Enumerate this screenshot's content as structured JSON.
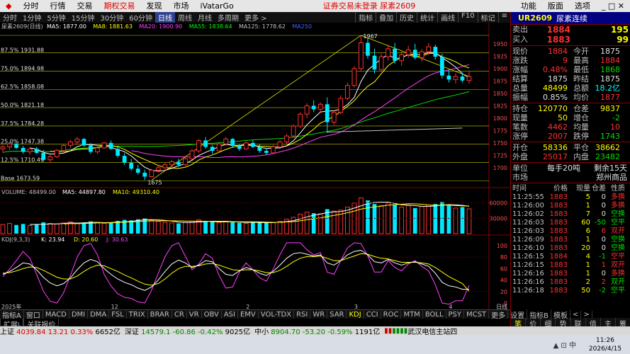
{
  "menu": {
    "items": [
      "分时",
      "行情",
      "交易",
      "期权交易",
      "发现",
      "市场",
      "iVatarGo"
    ],
    "active_index": 3,
    "notice": "证券交易未登录  尿素2609",
    "right": [
      "功能",
      "版面",
      "选项"
    ]
  },
  "periods": {
    "items": [
      "分时",
      "1分钟",
      "5分钟",
      "15分钟",
      "30分钟",
      "60分钟",
      "日线",
      "周线",
      "月线",
      "多周期",
      "更多 >"
    ],
    "active_index": 6,
    "tools": [
      "指标",
      "叠加",
      "历史",
      "统计",
      "画线",
      "F10",
      "标记",
      "≡"
    ]
  },
  "price_panel": {
    "legend_name": "尿素2609(日线)",
    "ma_legend": [
      {
        "text": "MA5: 1877.00",
        "color": "#ffffff"
      },
      {
        "text": "MA8: 1881.63",
        "color": "#ffff00"
      },
      {
        "text": "MA20: 1900.90",
        "color": "#ff40ff"
      },
      {
        "text": "MA55: 1838.64",
        "color": "#00ff00"
      },
      {
        "text": "MA125: 1778.62",
        "color": "#c0c0c0"
      },
      {
        "text": "MA250",
        "color": "#4060ff"
      }
    ],
    "ylim": [
      1667,
      1977
    ],
    "y_ticks": [
      1950,
      1925,
      1900,
      1875,
      1850,
      1825,
      1800,
      1775,
      1750,
      1725,
      1700
    ],
    "fib_levels": [
      {
        "label": "87.5% 1931.88",
        "value": 1931.88
      },
      {
        "label": "75.0% 1894.98",
        "value": 1894.98
      },
      {
        "label": "62.5% 1858.08",
        "value": 1858.08
      },
      {
        "label": "50.0% 1821.18",
        "value": 1821.18
      },
      {
        "label": "37.5% 1784.28",
        "value": 1784.28
      },
      {
        "label": "25.0% 1747.38",
        "value": 1747.38
      },
      {
        "label": "12.5% 1710.49",
        "value": 1710.49
      },
      {
        "label": "Base 1673.59",
        "value": 1673.59
      }
    ],
    "high_label": "1967",
    "low_label": "1675"
  },
  "volume_panel": {
    "legend": [
      {
        "text": "VOLUME: 48499.00",
        "color": "#c0c0c0"
      },
      {
        "text": "MA5: 44897.80",
        "color": "#ffffff"
      },
      {
        "text": "MA10: 49310.40",
        "color": "#ffff00"
      }
    ],
    "y_ticks": [
      "60000",
      "30000"
    ]
  },
  "kdj_panel": {
    "legend": [
      {
        "text": "KDJ(9,3,3)",
        "color": "#c0c0c0"
      },
      {
        "text": "K: 23.94",
        "color": "#ffffff"
      },
      {
        "text": "D: 20.60",
        "color": "#ffff00"
      },
      {
        "text": "J: 30.63",
        "color": "#ff40ff"
      }
    ],
    "y_ticks": [
      "100",
      "80",
      "60",
      "40",
      "20",
      "0"
    ]
  },
  "x_axis": {
    "labels": [
      "2025年",
      "12",
      "2",
      "3",
      "4"
    ],
    "corner": "日线"
  },
  "chart_data": {
    "type": "candlestick",
    "ohlc": [
      [
        1738,
        1746,
        1730,
        1742
      ],
      [
        1742,
        1752,
        1736,
        1748
      ],
      [
        1748,
        1750,
        1738,
        1740
      ],
      [
        1740,
        1744,
        1728,
        1732
      ],
      [
        1732,
        1740,
        1726,
        1738
      ],
      [
        1738,
        1742,
        1728,
        1730
      ],
      [
        1730,
        1736,
        1712,
        1716
      ],
      [
        1716,
        1726,
        1710,
        1722
      ],
      [
        1722,
        1738,
        1720,
        1735
      ],
      [
        1735,
        1748,
        1732,
        1745
      ],
      [
        1745,
        1756,
        1740,
        1752
      ],
      [
        1752,
        1762,
        1748,
        1758
      ],
      [
        1758,
        1760,
        1742,
        1745
      ],
      [
        1745,
        1750,
        1728,
        1732
      ],
      [
        1732,
        1744,
        1728,
        1740
      ],
      [
        1740,
        1752,
        1738,
        1750
      ],
      [
        1750,
        1755,
        1736,
        1738
      ],
      [
        1738,
        1744,
        1720,
        1724
      ],
      [
        1724,
        1730,
        1706,
        1710
      ],
      [
        1710,
        1718,
        1694,
        1698
      ],
      [
        1698,
        1706,
        1686,
        1690
      ],
      [
        1690,
        1696,
        1675,
        1682
      ],
      [
        1682,
        1698,
        1680,
        1695
      ],
      [
        1695,
        1704,
        1690,
        1700
      ],
      [
        1700,
        1710,
        1694,
        1706
      ],
      [
        1706,
        1716,
        1700,
        1712
      ],
      [
        1712,
        1718,
        1702,
        1706
      ],
      [
        1706,
        1722,
        1704,
        1718
      ],
      [
        1718,
        1738,
        1716,
        1734
      ],
      [
        1734,
        1758,
        1730,
        1755
      ],
      [
        1755,
        1762,
        1738,
        1742
      ],
      [
        1742,
        1746,
        1728,
        1734
      ],
      [
        1734,
        1752,
        1730,
        1748
      ],
      [
        1748,
        1762,
        1744,
        1758
      ],
      [
        1758,
        1760,
        1740,
        1744
      ],
      [
        1744,
        1748,
        1734,
        1738
      ],
      [
        1738,
        1754,
        1736,
        1750
      ],
      [
        1750,
        1756,
        1740,
        1742
      ],
      [
        1742,
        1748,
        1730,
        1734
      ],
      [
        1734,
        1740,
        1726,
        1730
      ],
      [
        1730,
        1746,
        1728,
        1742
      ],
      [
        1742,
        1756,
        1740,
        1752
      ],
      [
        1752,
        1768,
        1748,
        1764
      ],
      [
        1764,
        1788,
        1760,
        1784
      ],
      [
        1784,
        1812,
        1780,
        1808
      ],
      [
        1808,
        1830,
        1800,
        1825
      ],
      [
        1825,
        1836,
        1812,
        1818
      ],
      [
        1818,
        1832,
        1810,
        1828
      ],
      [
        1828,
        1842,
        1770,
        1792
      ],
      [
        1792,
        1816,
        1786,
        1812
      ],
      [
        1812,
        1846,
        1808,
        1840
      ],
      [
        1840,
        1872,
        1836,
        1866
      ],
      [
        1866,
        1905,
        1862,
        1900
      ],
      [
        1900,
        1967,
        1896,
        1952
      ],
      [
        1952,
        1962,
        1920,
        1926
      ],
      [
        1926,
        1940,
        1890,
        1898
      ],
      [
        1898,
        1930,
        1894,
        1924
      ],
      [
        1924,
        1948,
        1916,
        1940
      ],
      [
        1940,
        1952,
        1910,
        1916
      ],
      [
        1916,
        1934,
        1906,
        1928
      ],
      [
        1928,
        1946,
        1922,
        1938
      ],
      [
        1938,
        1950,
        1918,
        1922
      ],
      [
        1922,
        1940,
        1914,
        1934
      ],
      [
        1934,
        1952,
        1928,
        1944
      ],
      [
        1944,
        1948,
        1918,
        1924
      ],
      [
        1924,
        1930,
        1880,
        1886
      ],
      [
        1886,
        1898,
        1872,
        1878
      ],
      [
        1878,
        1890,
        1870,
        1884
      ],
      [
        1884,
        1892,
        1872,
        1876
      ],
      [
        1876,
        1894,
        1870,
        1884
      ]
    ],
    "ma": {
      "MA5": [
        1876,
        1878,
        1880,
        1882,
        1880,
        1879,
        1878,
        1877
      ],
      "MA20": [
        1918,
        1914,
        1910,
        1906,
        1903,
        1901,
        1900.9
      ],
      "MA55_end": 1838.64,
      "MA125_end": 1778.62
    },
    "volume": [
      18,
      20,
      17,
      19,
      16,
      18,
      22,
      20,
      19,
      21,
      23,
      20,
      22,
      24,
      21,
      20,
      22,
      25,
      27,
      26,
      28,
      30,
      26,
      24,
      22,
      21,
      20,
      22,
      24,
      27,
      25,
      23,
      22,
      24,
      23,
      21,
      20,
      22,
      23,
      21,
      22,
      24,
      28,
      32,
      38,
      42,
      40,
      39,
      48,
      44,
      46,
      52,
      60,
      70,
      65,
      58,
      55,
      60,
      57,
      52,
      55,
      50,
      53,
      56,
      58,
      62,
      55,
      50,
      52,
      48.5
    ],
    "kdj": {
      "K": [
        50,
        55,
        62,
        70,
        68,
        58,
        45,
        35,
        30,
        34,
        44,
        58,
        70,
        76,
        72,
        60,
        50,
        42,
        36,
        32,
        26,
        22,
        28,
        40,
        55,
        68,
        75,
        70,
        62,
        66,
        74,
        72,
        60,
        50,
        48,
        56,
        62,
        58,
        52,
        48,
        55,
        66,
        78,
        86,
        88,
        85,
        82,
        84,
        70,
        66,
        74,
        84,
        90,
        92,
        84,
        72,
        70,
        76,
        70,
        66,
        70,
        72,
        68,
        64,
        52,
        36,
        30,
        28,
        24,
        23.94
      ],
      "D": [
        52,
        53,
        56,
        60,
        63,
        62,
        57,
        51,
        45,
        42,
        42,
        47,
        55,
        62,
        66,
        65,
        60,
        55,
        49,
        44,
        38,
        33,
        31,
        34,
        42,
        52,
        60,
        64,
        64,
        65,
        68,
        69,
        66,
        62,
        58,
        57,
        58,
        58,
        56,
        53,
        53,
        57,
        64,
        72,
        78,
        81,
        81,
        82,
        78,
        74,
        74,
        78,
        82,
        86,
        85,
        81,
        78,
        77,
        74,
        71,
        71,
        71,
        70,
        68,
        62,
        54,
        46,
        40,
        34,
        20.6
      ]
    }
  },
  "quote": {
    "code": "UR2609",
    "name": "尿素连续",
    "sell": {
      "label": "卖出",
      "price": "1884",
      "vol": "195"
    },
    "buy": {
      "label": "买入",
      "price": "1883",
      "vol": "99"
    },
    "rows1": [
      {
        "l": "现价",
        "v": "1884",
        "vc": "red",
        "l2": "今开",
        "v2": "1875",
        "v2c": "wht"
      },
      {
        "l": "涨跌",
        "v": "9",
        "vc": "red",
        "l2": "最高",
        "v2": "1884",
        "v2c": "red"
      },
      {
        "l": "涨幅",
        "v": "0.48%",
        "vc": "red",
        "l2": "最低",
        "v2": "1868",
        "v2c": "grn"
      },
      {
        "l": "结算",
        "v": "1875",
        "vc": "wht",
        "l2": "昨结",
        "v2": "1875",
        "v2c": "wht"
      },
      {
        "l": "总量",
        "v": "48499",
        "vc": "yel",
        "l2": "总额",
        "v2": "18.2亿",
        "v2c": "cyan"
      },
      {
        "l": "振幅",
        "v": "0.85%",
        "vc": "wht",
        "l2": "均价",
        "v2": "1877",
        "v2c": "red"
      }
    ],
    "rows2": [
      {
        "l": "持仓",
        "v": "120770",
        "vc": "yel",
        "l2": "仓差",
        "v2": "9837",
        "v2c": "yel"
      },
      {
        "l": "现量",
        "v": "50",
        "vc": "yel",
        "l2": "增仓",
        "v2": "-2",
        "v2c": "grn"
      },
      {
        "l": "笔数",
        "v": "4462",
        "vc": "red",
        "l2": "均量",
        "v2": "10",
        "v2c": "red"
      },
      {
        "l": "涨停",
        "v": "2007",
        "vc": "red",
        "l2": "跌停",
        "v2": "1743",
        "v2c": "grn"
      }
    ],
    "rows3": [
      {
        "l": "开仓",
        "v": "58336",
        "vc": "yel",
        "l2": "平仓",
        "v2": "38662",
        "v2c": "yel"
      },
      {
        "l": "外盘",
        "v": "25017",
        "vc": "red",
        "l2": "内盘",
        "v2": "23482",
        "v2c": "grn"
      }
    ],
    "unit": {
      "label": "单位",
      "value": "每手20吨",
      "remain": "剩余15天"
    },
    "market": {
      "label": "市场",
      "value": "郑州商品"
    },
    "tick_headers": [
      "时间",
      "价格",
      "现量",
      "仓差",
      "性质"
    ],
    "ticks": [
      [
        "11:25:55",
        "1883",
        "5",
        "0",
        "多换",
        "red"
      ],
      [
        "11:26:00",
        "1883",
        "1",
        "0",
        "多换",
        "red"
      ],
      [
        "11:26:02",
        "1883",
        "7",
        "0",
        "空换",
        "grn"
      ],
      [
        "11:26:03",
        "1883",
        "60",
        "-50",
        "空平",
        "grn"
      ],
      [
        "11:26:03",
        "1883",
        "6",
        "6",
        "双开",
        "red"
      ],
      [
        "11:26:09",
        "1883",
        "1",
        "0",
        "空换",
        "grn"
      ],
      [
        "11:26:10",
        "1883",
        "20",
        "0",
        "空换",
        "grn"
      ],
      [
        "11:26:15",
        "1884",
        "4",
        "-1",
        "空平",
        "red"
      ],
      [
        "11:26:15",
        "1883",
        "1",
        "1",
        "双开",
        "red"
      ],
      [
        "11:26:16",
        "1883",
        "1",
        "0",
        "多换",
        "red"
      ],
      [
        "11:26:16",
        "1883",
        "2",
        "2",
        "双开",
        "grn"
      ],
      [
        "11:26:18",
        "1883",
        "50",
        "-2",
        "空平",
        "grn"
      ]
    ],
    "tabs": [
      "笔",
      "价",
      "细",
      "势",
      "联",
      "值",
      "主",
      "筹"
    ]
  },
  "indicators": {
    "items": [
      "指标A",
      "窗口",
      "MACD",
      "DMI",
      "DMA",
      "FSL",
      "TRIX",
      "BRAR",
      "CR",
      "VR",
      "OBV",
      "ASI",
      "EMV",
      "VOL-TDX",
      "RSI",
      "WR",
      "SAR",
      "KDJ",
      "CCI",
      "ROC",
      "MTM",
      "BOLL",
      "PSY",
      "MCST",
      "更多",
      "设置"
    ],
    "active_index": 17,
    "right": [
      "指标B",
      "模板",
      "<",
      ">"
    ]
  },
  "sub_tabs": [
    "扩展\\",
    "关联报价"
  ],
  "status": [
    {
      "name": "上证",
      "val": "4039.84",
      "chg": "13.21",
      "pct": "0.33%",
      "amt": "6652亿",
      "dir": "up"
    },
    {
      "name": "深证",
      "val": "14579.1",
      "chg": "-60.86",
      "pct": "-0.42%",
      "amt": "9025亿",
      "dir": "down"
    },
    {
      "name": "中小",
      "val": "8904.70",
      "chg": "-53.20",
      "pct": "-0.59%",
      "amt": "1191亿",
      "dir": "down"
    }
  ],
  "status_right": "武汉电信主站四",
  "clock": {
    "time": "11:26",
    "date": "2026/4/15"
  }
}
